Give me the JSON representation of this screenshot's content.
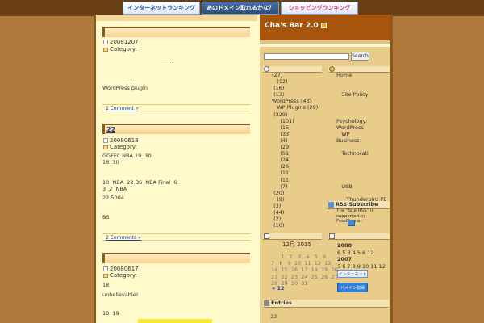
{
  "banners": [
    "インターネットランキング",
    "あのドメイン取れるかな？",
    "ショッピングランキング"
  ],
  "blog": {
    "title": "Cha's Bar 2.0"
  },
  "posts": [
    {
      "date": "20081207",
      "category_label": "Category:",
      "lines": [
        "........",
        "",
        "",
        "......",
        "WordPress plugin"
      ],
      "comments": "1 Comment »"
    },
    {
      "number": "22",
      "date": "20080618",
      "category_label": "Category:",
      "lines": [
        "GGFFC NBA 19  30",
        "16  30",
        "",
        "",
        "10  NBA  22 BS  NBA Final  6",
        "3  2  NBA",
        "",
        "22 5004",
        "",
        "",
        "BS"
      ],
      "comments": "2 Comments »"
    },
    {
      "date": "20080617",
      "category_label": "Category:",
      "lines": [
        "18",
        "",
        "unbelievable!",
        "",
        "",
        "",
        "18  19"
      ]
    }
  ],
  "search": {
    "button": "Search",
    "placeholder": ""
  },
  "sidebar_left_list": "(27)\n   (12)\n (16)\n (13)\nWordPress (43)\n   WP Plugins (20)\n (329)\n     (101)\n     (15)\n     (33)\n     (4)\n     (29)\n     (51)\n     (24)\n     (26)\n     (11)\n     (11)\n     (7)\n (20)\n   (9)\n (3)\n (44)\n (2)\n (10)",
  "sidebar_right_list": "Home\n\n\n   Site Policy\n\n\n\nPsychology:\nWordPress\n   WP\nBusiness\n\n   Technorati\n\n\n\n\n   USB\n\n      Thunderbird PE\nSBM\n\n\n\n ",
  "rss": {
    "heading": "RSS Subscribe",
    "text": "The \"Site RSS\" is supported by FeedBurner."
  },
  "calendar": {
    "title": "12月 2015",
    "grid": "      1   2   3   4   5   6\n7   8   9  10  11  12  13\n14  15  16  17  18  19  20\n21  22  23  24  25  26  27\n28  29  30  31",
    "prev": "« 12"
  },
  "archive": {
    "y2008": "2008",
    "m2008": "6 5 3 4 5 6 12",
    "y2007": "2007",
    "m2007": "5 6 7 8 9 10 11 12"
  },
  "badges": {
    "b1": "インターネット",
    "b2": "ドメイン取得"
  },
  "entries": {
    "heading": "Entries",
    "count": "22"
  }
}
